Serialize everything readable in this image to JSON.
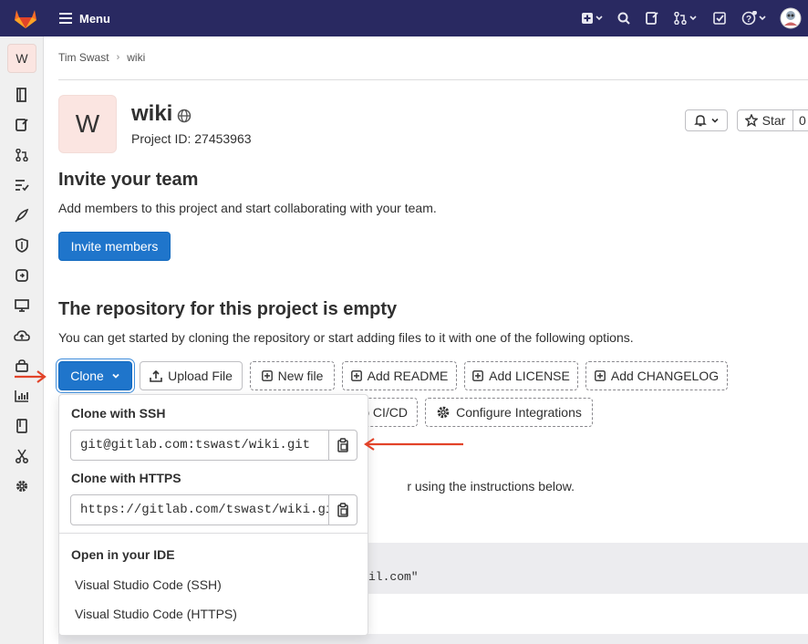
{
  "topbar": {
    "menu_label": "Menu"
  },
  "sidebar": {
    "avatar_letter": "W"
  },
  "breadcrumb": {
    "owner": "Tim Swast",
    "project": "wiki"
  },
  "project": {
    "avatar_letter": "W",
    "title": "wiki",
    "id_text": "Project ID: 27453963",
    "star_label": "Star",
    "star_count": "0"
  },
  "invite": {
    "heading": "Invite your team",
    "description": "Add members to this project and start collaborating with your team.",
    "button_label": "Invite members"
  },
  "empty_repo": {
    "heading": "The repository for this project is empty",
    "description": "You can get started by cloning the repository or start adding files to it with one of the following options.",
    "buttons": {
      "clone": "Clone",
      "upload": "Upload File",
      "new_file": "New file",
      "readme": "Add README",
      "license": "Add LICENSE",
      "changelog": "Add CHANGELOG",
      "cicd": "o CI/CD",
      "integrations": "Configure Integrations"
    },
    "instructions_fragment": "r using the instructions below.",
    "code_fragment": "il.com\""
  },
  "clone_dropdown": {
    "ssh_label": "Clone with SSH",
    "ssh_url": "git@gitlab.com:tswast/wiki.git",
    "https_label": "Clone with HTTPS",
    "https_url": "https://gitlab.com/tswast/wiki.git",
    "ide_label": "Open in your IDE",
    "ide_items": [
      "Visual Studio Code (SSH)",
      "Visual Studio Code (HTTPS)"
    ]
  },
  "colors": {
    "topbar": "#292961",
    "primary": "#1f75cb",
    "annotation_arrow": "#e24329"
  }
}
